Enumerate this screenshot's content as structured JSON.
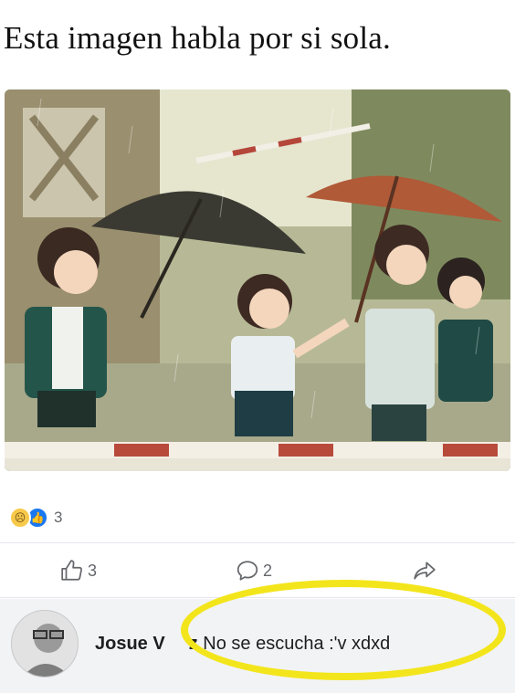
{
  "post": {
    "title": "Esta imagen habla por si sola."
  },
  "illustration": {
    "description_icon": "rainy-school-illustration"
  },
  "reactions": {
    "icons": [
      "sad-reaction-icon",
      "like-reaction-icon"
    ],
    "count": "3"
  },
  "actions": {
    "like_count": "3",
    "comment_count": "2",
    "share_icon": "share-icon"
  },
  "comment": {
    "author": "Josue V",
    "author_hidden_tail": "z",
    "text": "No se escucha :'v xdxd"
  },
  "colors": {
    "highlight": "#f3e51b",
    "comment_bg": "#f2f3f5",
    "muted": "#65676b"
  }
}
